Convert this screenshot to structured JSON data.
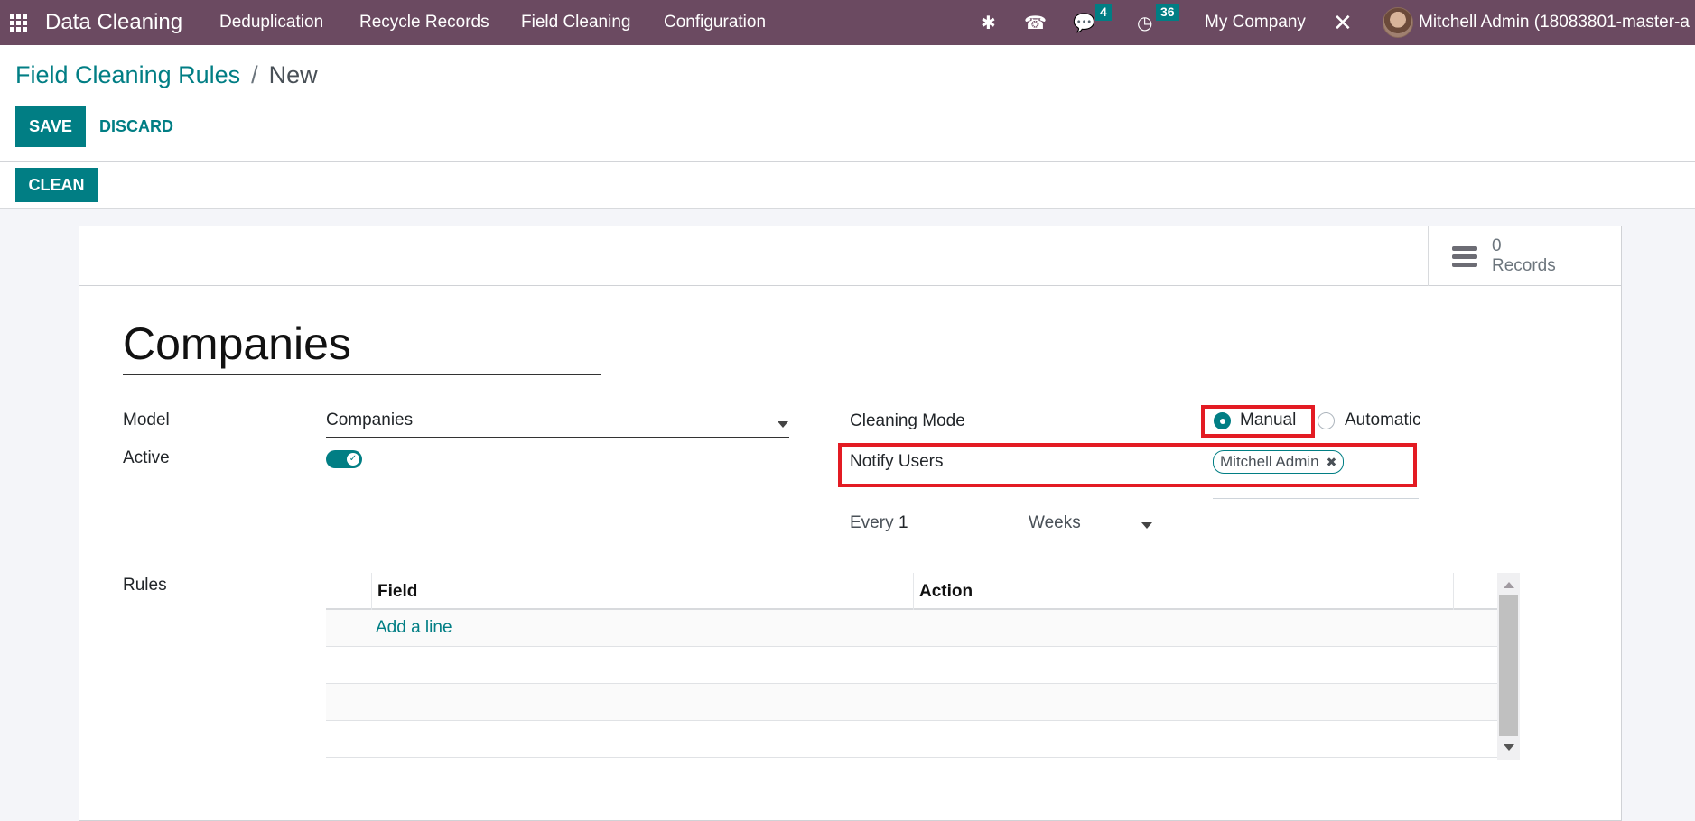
{
  "navbar": {
    "brand": "Data Cleaning",
    "menu": [
      "Deduplication",
      "Recycle Records",
      "Field Cleaning",
      "Configuration"
    ],
    "messages_count": "4",
    "activities_count": "36",
    "company": "My Company",
    "user": "Mitchell Admin (18083801-master-a"
  },
  "breadcrumb": {
    "parent": "Field Cleaning Rules",
    "separator": "/",
    "current": "New"
  },
  "buttons": {
    "save": "SAVE",
    "discard": "DISCARD",
    "clean": "CLEAN"
  },
  "stat": {
    "value": "0",
    "label": "Records"
  },
  "form": {
    "title": "Companies",
    "model_label": "Model",
    "model_value": "Companies",
    "active_label": "Active",
    "active": true,
    "cleaning_mode_label": "Cleaning Mode",
    "cleaning_mode_options": [
      "Manual",
      "Automatic"
    ],
    "cleaning_mode_selected": "Manual",
    "notify_users_label": "Notify Users",
    "notify_users_tags": [
      "Mitchell Admin"
    ],
    "every_label": "Every",
    "every_value": "1",
    "period": "Weeks",
    "rules_label": "Rules",
    "rules_columns": [
      "Field",
      "Action"
    ],
    "add_line": "Add a line"
  },
  "colors": {
    "navbar": "#6b4a61",
    "primary": "#017e84",
    "highlight": "#e31b23"
  }
}
